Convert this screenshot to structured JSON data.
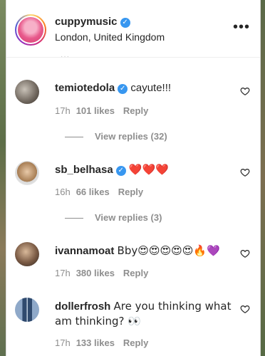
{
  "post": {
    "username": "cuppymusic",
    "verified_mark": "✓",
    "location": "London, United Kingdom",
    "more_icon": "•••"
  },
  "comments": [
    {
      "username": "temiotedola",
      "verified": true,
      "text": "cayute!!!",
      "time": "17h",
      "likes": "101 likes",
      "reply_label": "Reply",
      "view_replies": "View replies (32)"
    },
    {
      "username": "sb_belhasa",
      "verified": true,
      "text": "❤️❤️❤️",
      "time": "16h",
      "likes": "66 likes",
      "reply_label": "Reply",
      "view_replies": "View replies (3)"
    },
    {
      "username": "ivannamoat",
      "verified": false,
      "text": "Bby😍😍😍😍😍🔥💜",
      "time": "17h",
      "likes": "380 likes",
      "reply_label": "Reply"
    },
    {
      "username": "dollerfrosh",
      "verified": false,
      "text": "Are you thinking what am thinking? 👀",
      "time": "17h",
      "likes": "133 likes",
      "reply_label": "Reply"
    }
  ],
  "icons": {
    "heart": "heart-outline-icon",
    "verified": "verified-badge-icon",
    "more": "more-options-icon"
  },
  "colors": {
    "verified": "#3897f0",
    "muted": "#8e8e8e",
    "text": "#262626"
  }
}
